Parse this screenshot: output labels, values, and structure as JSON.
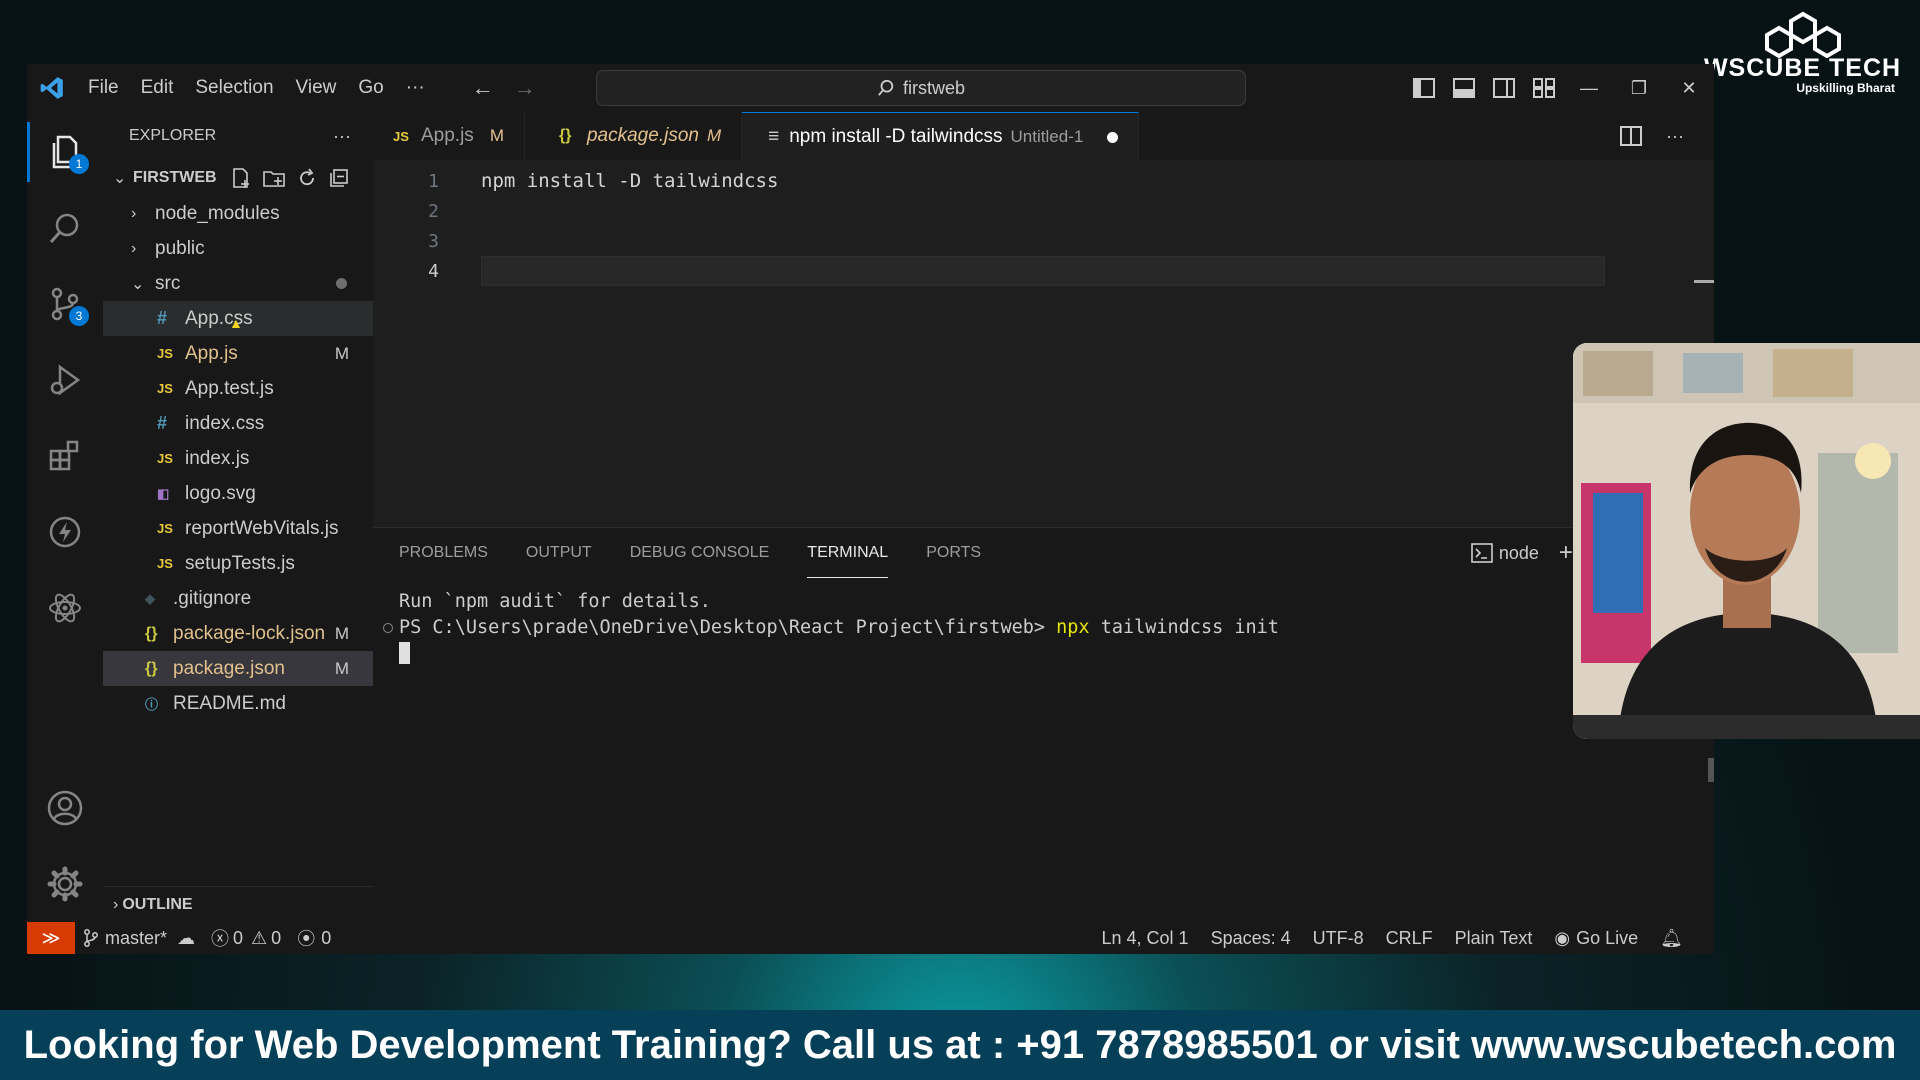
{
  "brand": {
    "name": "WSCUBE TECH",
    "tagline": "Upskilling Bharat"
  },
  "menu": [
    "File",
    "Edit",
    "Selection",
    "View",
    "Go",
    "···"
  ],
  "search": {
    "text": "firstweb"
  },
  "activity_badges": {
    "explorer": "1",
    "source_control": "3"
  },
  "sidebar": {
    "title": "EXPLORER",
    "more": "···",
    "project": "FIRSTWEB",
    "tree": [
      {
        "name": "node_modules",
        "type": "folder",
        "indent": 0,
        "open": false,
        "status": ""
      },
      {
        "name": "public",
        "type": "folder",
        "indent": 0,
        "open": false,
        "status": ""
      },
      {
        "name": "src",
        "type": "folder",
        "indent": 0,
        "open": true,
        "status": "dot"
      },
      {
        "name": "App.css",
        "type": "css",
        "indent": 1,
        "status": "",
        "state": "highlight"
      },
      {
        "name": "App.js",
        "type": "js",
        "indent": 1,
        "status": "M"
      },
      {
        "name": "App.test.js",
        "type": "js",
        "indent": 1,
        "status": ""
      },
      {
        "name": "index.css",
        "type": "css",
        "indent": 1,
        "status": ""
      },
      {
        "name": "index.js",
        "type": "js",
        "indent": 1,
        "status": ""
      },
      {
        "name": "logo.svg",
        "type": "svg",
        "indent": 1,
        "status": ""
      },
      {
        "name": "reportWebVitals.js",
        "type": "js",
        "indent": 1,
        "status": ""
      },
      {
        "name": "setupTests.js",
        "type": "js",
        "indent": 1,
        "status": ""
      },
      {
        "name": ".gitignore",
        "type": "git",
        "indent": 0,
        "status": ""
      },
      {
        "name": "package-lock.json",
        "type": "json",
        "indent": 0,
        "status": "M"
      },
      {
        "name": "package.json",
        "type": "json",
        "indent": 0,
        "status": "M",
        "state": "selected"
      },
      {
        "name": "README.md",
        "type": "info",
        "indent": 0,
        "status": ""
      }
    ],
    "outline": "OUTLINE"
  },
  "tabs": [
    {
      "icon": "JS",
      "label": "App.js",
      "mod": "M",
      "active": false
    },
    {
      "icon": "{}",
      "label": "package.json",
      "mod": "M",
      "active": false,
      "italic": true
    },
    {
      "icon": "≡",
      "label": "npm install -D tailwindcss",
      "sub": "Untitled-1",
      "active": true,
      "dirty": true
    }
  ],
  "editor": {
    "lines": [
      {
        "n": "1",
        "text": "npm install -D tailwindcss"
      },
      {
        "n": "2",
        "text": ""
      },
      {
        "n": "3",
        "text": ""
      },
      {
        "n": "4",
        "text": ""
      }
    ]
  },
  "panel": {
    "tabs": [
      "PROBLEMS",
      "OUTPUT",
      "DEBUG CONSOLE",
      "TERMINAL",
      "PORTS"
    ],
    "active_tab": "TERMINAL",
    "shell": "node",
    "terminal": {
      "line1": "Run `npm audit` for details.",
      "prompt": "PS C:\\Users\\prade\\OneDrive\\Desktop\\React Project\\firstweb> ",
      "cmd": "npx",
      "args": " tailwindcss init"
    }
  },
  "statusbar": {
    "branch": "master*",
    "errors": "0",
    "warnings": "0",
    "ports": "0",
    "position": "Ln 4, Col 1",
    "spaces": "Spaces: 4",
    "encoding": "UTF-8",
    "eol": "CRLF",
    "language": "Plain Text",
    "golive": "Go Live"
  },
  "banner": {
    "text": "Looking for Web Development Training? Call us at : +91 7878985501 or visit www.wscubetech.com"
  },
  "colors": {
    "accent": "#0078d4",
    "modified": "#e2c08d",
    "remote": "#d83b01",
    "banner": "#063f58"
  }
}
